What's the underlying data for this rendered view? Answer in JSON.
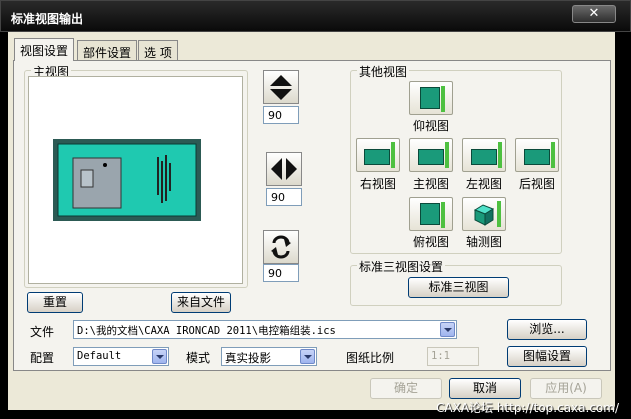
{
  "window": {
    "title": "标准视图输出",
    "close_symbol": "✕"
  },
  "tabs": [
    {
      "label": "视图设置",
      "active": true
    },
    {
      "label": "部件设置",
      "active": false
    },
    {
      "label": "选  项",
      "active": false
    }
  ],
  "main_view": {
    "label": "主视图",
    "reset_label": "重置",
    "from_file_label": "来自文件"
  },
  "spinners": [
    {
      "icon": "vertical-flip-icon",
      "value": "90"
    },
    {
      "icon": "horizontal-flip-icon",
      "value": "90"
    },
    {
      "icon": "rotate-icon",
      "value": "90"
    }
  ],
  "other_views": {
    "label": "其他视图",
    "views": [
      {
        "key": "bottom",
        "label": "仰视图"
      },
      {
        "key": "right",
        "label": "右视图"
      },
      {
        "key": "front",
        "label": "主视图"
      },
      {
        "key": "left",
        "label": "左视图"
      },
      {
        "key": "back",
        "label": "后视图"
      },
      {
        "key": "top",
        "label": "俯视图"
      },
      {
        "key": "iso",
        "label": "轴测图"
      }
    ]
  },
  "std_three": {
    "label": "标准三视图设置",
    "button_label": "标准三视图"
  },
  "file": {
    "label": "文件",
    "value": "D:\\我的文档\\CAXA IRONCAD 2011\\电控箱组装.ics",
    "browse_label": "浏览..."
  },
  "config": {
    "label": "配置",
    "value": "Default"
  },
  "mode": {
    "label": "模式",
    "value": "真实投影"
  },
  "scale": {
    "label": "图纸比例",
    "value": "1:1"
  },
  "sheet_setup_label": "图幅设置",
  "footer": {
    "ok": "确定",
    "cancel": "取消",
    "apply": "应用(A)"
  },
  "watermark": "CAXA论坛 http://top.caxa.com/",
  "colors": {
    "teal": "#1fc9b0",
    "frame": "#1b5a50",
    "gray": "#9aa5ad"
  }
}
